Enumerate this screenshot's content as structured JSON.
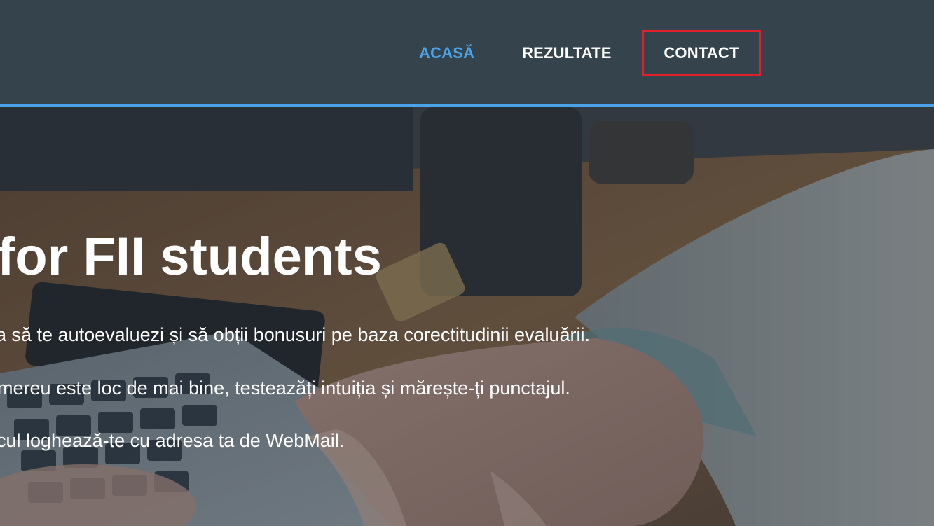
{
  "nav": {
    "items": [
      {
        "label": "ACASĂ",
        "active": true
      },
      {
        "label": "REZULTATE",
        "active": false
      },
      {
        "label": "CONTACT",
        "active": false,
        "highlighted": true
      }
    ]
  },
  "hero": {
    "title": "for FII students",
    "lines": [
      "a să te autoevaluezi și să obții bonusuri pe baza corectitudinii evaluării.",
      "mereu este loc de mai bine, testeazăți intuiția și mărește-ți punctajul.",
      "cul loghează-te cu adresa ta de WebMail."
    ]
  },
  "colors": {
    "navbar_bg": "#35434c",
    "accent": "#4aa3e8",
    "highlight_border": "#e0202a",
    "text": "#ffffff"
  }
}
